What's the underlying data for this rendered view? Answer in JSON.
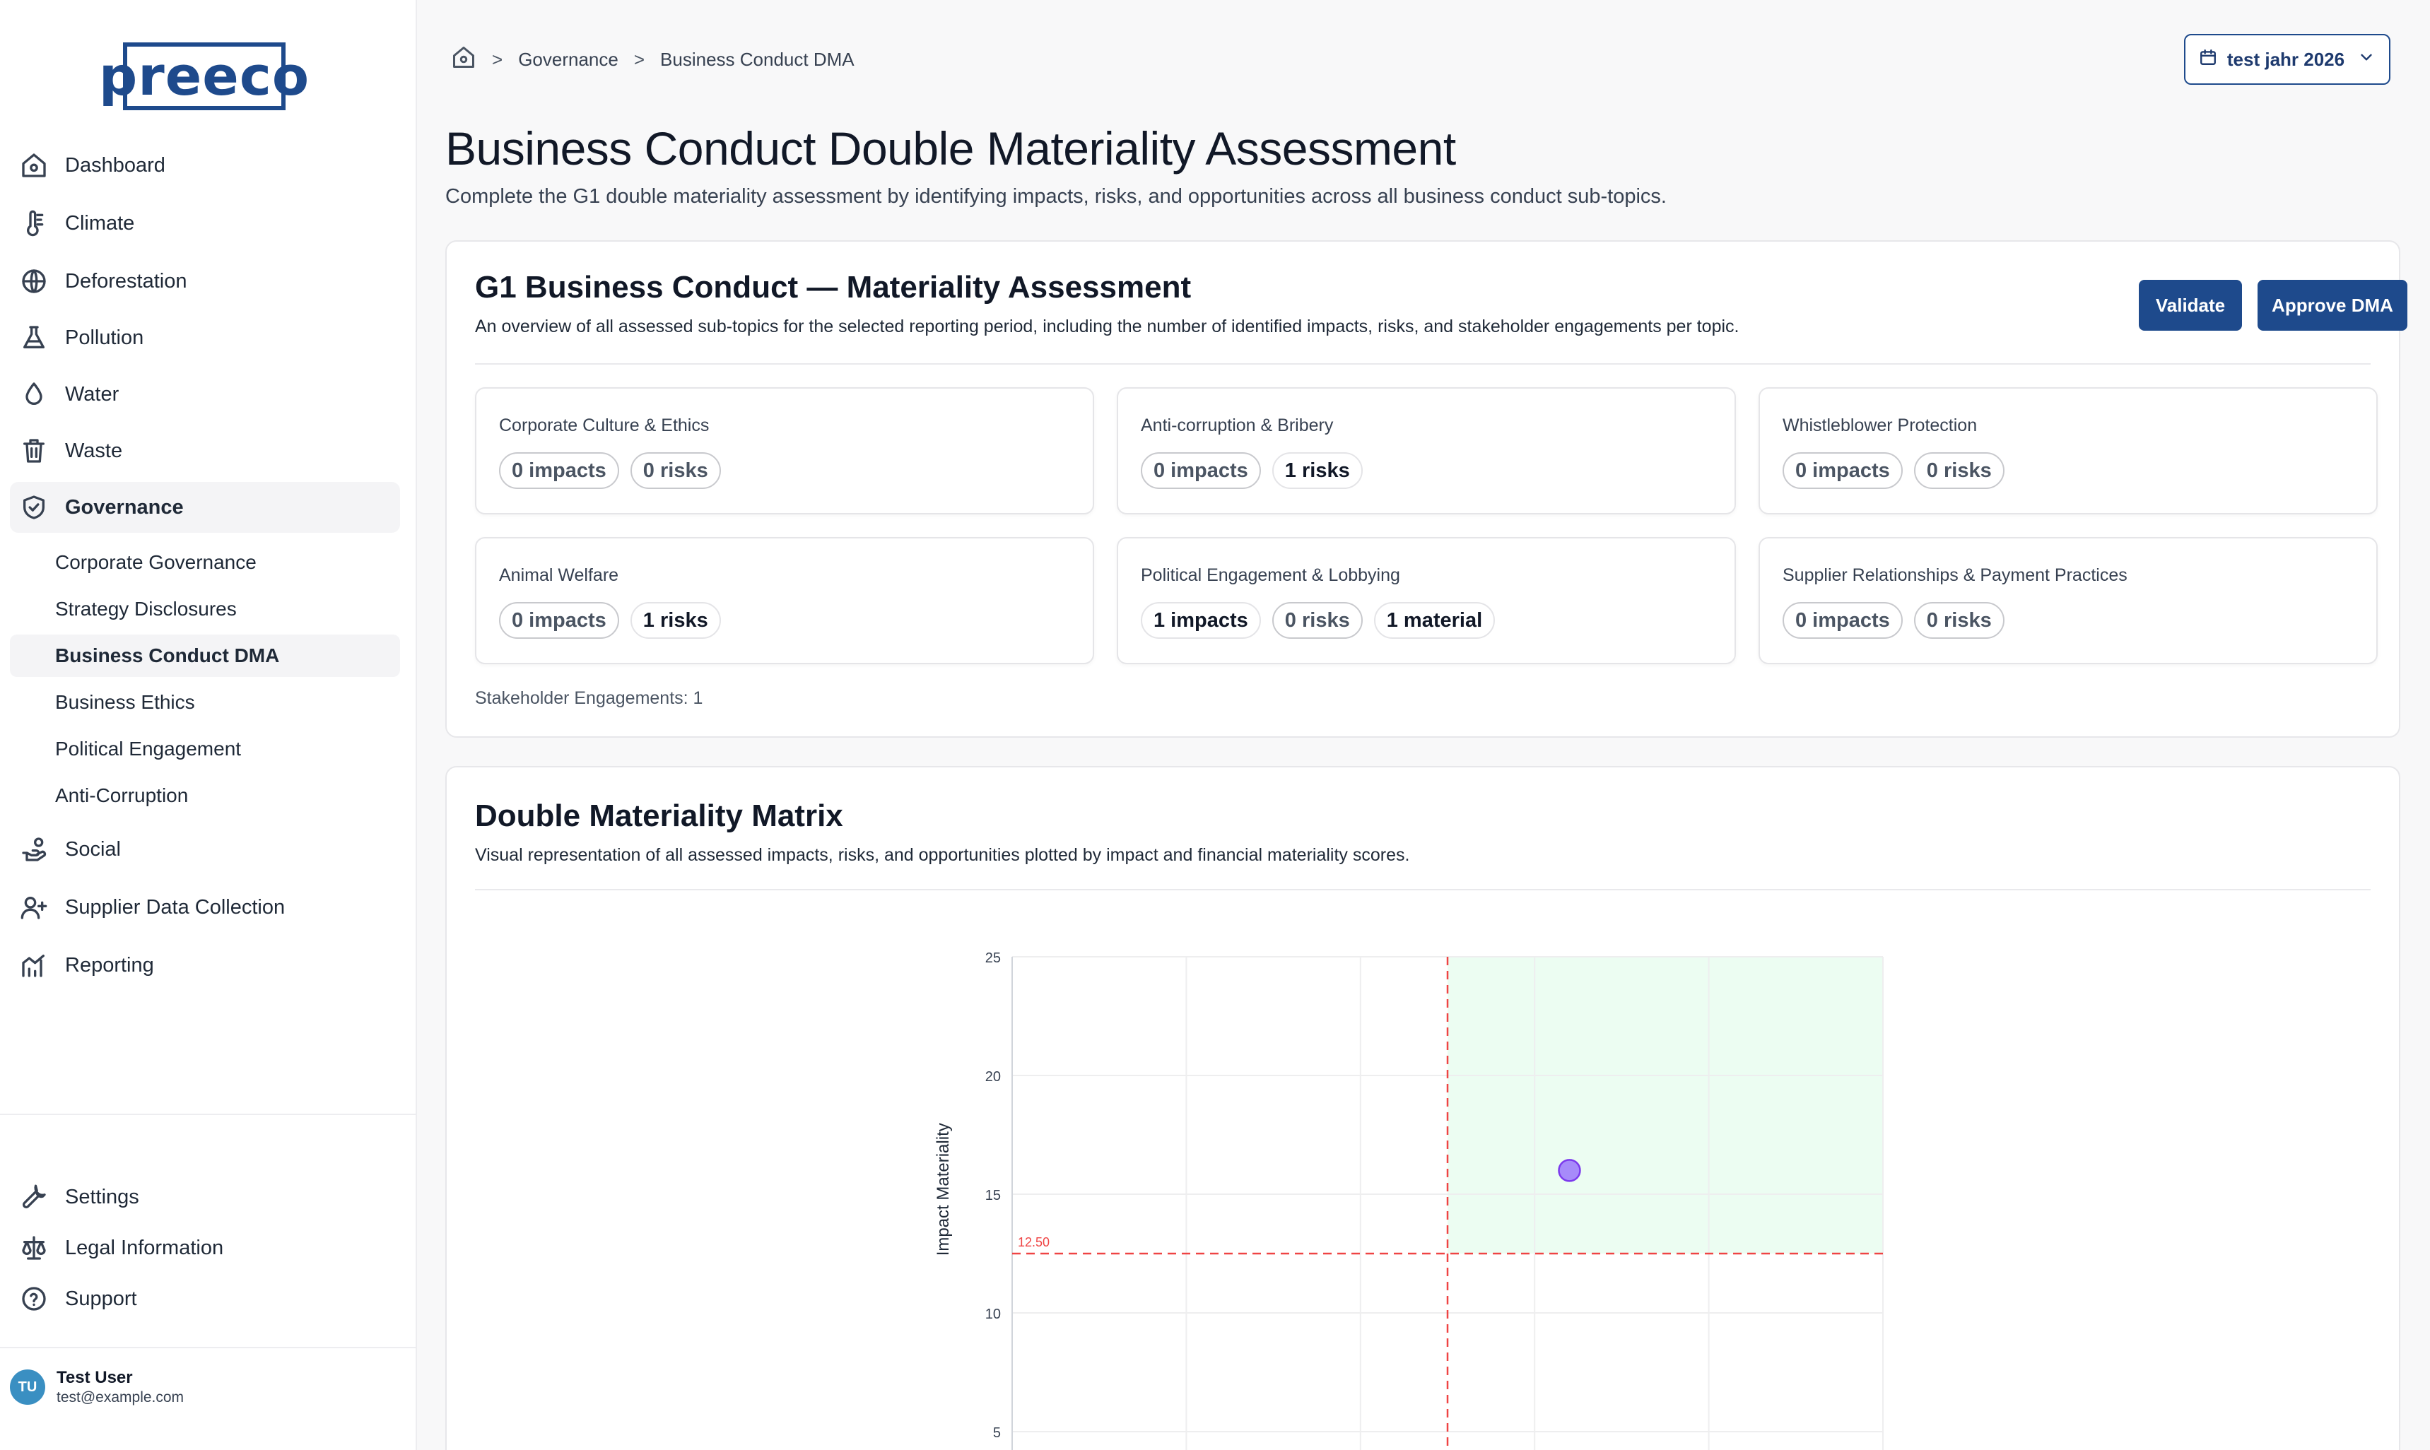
{
  "app": {
    "logo_text": "preeco"
  },
  "sidebar": {
    "items": [
      {
        "label": "Dashboard",
        "icon": "home-icon"
      },
      {
        "label": "Climate",
        "icon": "thermometer-icon"
      },
      {
        "label": "Deforestation",
        "icon": "globe-icon"
      },
      {
        "label": "Pollution",
        "icon": "flask-icon"
      },
      {
        "label": "Water",
        "icon": "droplet-icon"
      },
      {
        "label": "Waste",
        "icon": "trash-icon"
      },
      {
        "label": "Governance",
        "icon": "shield-check-icon"
      },
      {
        "label": "Social",
        "icon": "hand-coins-icon"
      },
      {
        "label": "Supplier Data Collection",
        "icon": "user-plus-icon"
      },
      {
        "label": "Reporting",
        "icon": "chart-trend-icon"
      }
    ],
    "governance_sub": [
      {
        "label": "Corporate Governance"
      },
      {
        "label": "Strategy Disclosures"
      },
      {
        "label": "Business Conduct DMA"
      },
      {
        "label": "Business Ethics"
      },
      {
        "label": "Political Engagement"
      },
      {
        "label": "Anti-Corruption"
      }
    ],
    "bottom": [
      {
        "label": "Settings",
        "icon": "wrench-icon"
      },
      {
        "label": "Legal Information",
        "icon": "scale-icon"
      },
      {
        "label": "Support",
        "icon": "help-circle-icon"
      }
    ],
    "user": {
      "initials": "TU",
      "name": "Test User",
      "email": "test@example.com"
    }
  },
  "breadcrumb": {
    "home_icon": "home-icon",
    "items": [
      "Governance",
      "Business Conduct DMA"
    ],
    "separator": ">"
  },
  "period": {
    "label": "test jahr 2026",
    "icon": "calendar-icon",
    "chevron": "chevron-down-icon"
  },
  "page": {
    "title": "Business Conduct Double Materiality Assessment",
    "subtitle": "Complete the G1 double materiality assessment by identifying impacts, risks, and opportunities across all business conduct sub-topics."
  },
  "assessment": {
    "title": "G1 Business Conduct — Materiality Assessment",
    "description": "An overview of all assessed sub-topics for the selected reporting period, including the number of identified impacts, risks, and stakeholder engagements per topic.",
    "validate_label": "Validate",
    "approve_label": "Approve DMA",
    "topics": [
      {
        "name": "Corporate Culture & Ethics",
        "pills": [
          "0 impacts",
          "0 risks"
        ]
      },
      {
        "name": "Anti-corruption & Bribery",
        "pills": [
          "0 impacts",
          "1 risks"
        ]
      },
      {
        "name": "Whistleblower Protection",
        "pills": [
          "0 impacts",
          "0 risks"
        ]
      },
      {
        "name": "Animal Welfare",
        "pills": [
          "0 impacts",
          "1 risks"
        ]
      },
      {
        "name": "Political Engagement & Lobbying",
        "pills": [
          "1 impacts",
          "0 risks",
          "1 material"
        ]
      },
      {
        "name": "Supplier Relationships & Payment Practices",
        "pills": [
          "0 impacts",
          "0 risks"
        ]
      }
    ],
    "engagements": "Stakeholder Engagements: 1"
  },
  "matrix": {
    "title": "Double Materiality Matrix",
    "description": "Visual representation of all assessed impacts, risks, and opportunities plotted by impact and financial materiality scores."
  },
  "chart_data": {
    "type": "scatter",
    "ylabel": "Impact Materiality",
    "xlabel": "",
    "ylim": [
      0,
      25
    ],
    "xlim": [
      0,
      25
    ],
    "yticks": [
      5,
      10,
      15,
      20,
      25
    ],
    "threshold": {
      "y": 12.5,
      "x": 12.5,
      "label": "12.50"
    },
    "material_region": "top-right",
    "grid": true,
    "points": [
      {
        "x": 16,
        "y": 16
      }
    ],
    "colors": {
      "point": "#a78bfa",
      "threshold": "#ef4444",
      "region": "#dcfce7"
    }
  }
}
